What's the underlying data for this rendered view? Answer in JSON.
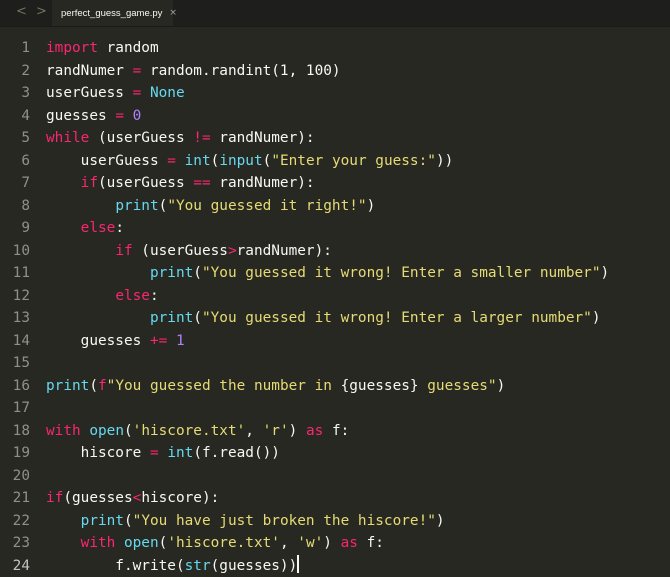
{
  "window": {
    "back_arrow": "<",
    "forward_arrow": ">",
    "tab": {
      "label": "perfect_guess_game.py",
      "close": "×"
    }
  },
  "editor": {
    "current_line": 24,
    "lines": [
      {
        "number": "1",
        "tokens": [
          [
            "kw",
            "import"
          ],
          [
            "pl",
            " random"
          ]
        ]
      },
      {
        "number": "2",
        "tokens": [
          [
            "pl",
            "randNumer "
          ],
          [
            "op",
            "="
          ],
          [
            "pl",
            " random.randint(1, 100)"
          ]
        ]
      },
      {
        "number": "3",
        "tokens": [
          [
            "pl",
            "userGuess "
          ],
          [
            "op",
            "="
          ],
          [
            "pl",
            " "
          ],
          [
            "cn",
            "None"
          ]
        ]
      },
      {
        "number": "4",
        "tokens": [
          [
            "pl",
            "guesses "
          ],
          [
            "op",
            "="
          ],
          [
            "pl",
            " "
          ],
          [
            "nm",
            "0"
          ]
        ]
      },
      {
        "number": "5",
        "tokens": [
          [
            "kw",
            "while"
          ],
          [
            "pl",
            " (userGuess "
          ],
          [
            "op",
            "!="
          ],
          [
            "pl",
            " randNumer):"
          ]
        ]
      },
      {
        "number": "6",
        "tokens": [
          [
            "pl",
            "    userGuess "
          ],
          [
            "op",
            "="
          ],
          [
            "pl",
            " "
          ],
          [
            "fn",
            "int"
          ],
          [
            "pl",
            "("
          ],
          [
            "fn",
            "input"
          ],
          [
            "pl",
            "("
          ],
          [
            "st",
            "\"Enter your guess:\""
          ],
          [
            "pl",
            "))"
          ]
        ]
      },
      {
        "number": "7",
        "tokens": [
          [
            "pl",
            "    "
          ],
          [
            "kw",
            "if"
          ],
          [
            "pl",
            "(userGuess "
          ],
          [
            "op",
            "=="
          ],
          [
            "pl",
            " randNumer):"
          ]
        ]
      },
      {
        "number": "8",
        "tokens": [
          [
            "pl",
            "        "
          ],
          [
            "fn",
            "print"
          ],
          [
            "pl",
            "("
          ],
          [
            "st",
            "\"You guessed it right!\""
          ],
          [
            "pl",
            ")"
          ]
        ]
      },
      {
        "number": "9",
        "tokens": [
          [
            "pl",
            "    "
          ],
          [
            "kw",
            "else"
          ],
          [
            "pl",
            ":"
          ]
        ]
      },
      {
        "number": "10",
        "tokens": [
          [
            "pl",
            "        "
          ],
          [
            "kw",
            "if"
          ],
          [
            "pl",
            " (userGuess"
          ],
          [
            "op",
            ">"
          ],
          [
            "pl",
            "randNumer):"
          ]
        ]
      },
      {
        "number": "11",
        "tokens": [
          [
            "pl",
            "            "
          ],
          [
            "fn",
            "print"
          ],
          [
            "pl",
            "("
          ],
          [
            "st",
            "\"You guessed it wrong! Enter a smaller number\""
          ],
          [
            "pl",
            ")"
          ]
        ]
      },
      {
        "number": "12",
        "tokens": [
          [
            "pl",
            "        "
          ],
          [
            "kw",
            "else"
          ],
          [
            "pl",
            ":"
          ]
        ]
      },
      {
        "number": "13",
        "tokens": [
          [
            "pl",
            "            "
          ],
          [
            "fn",
            "print"
          ],
          [
            "pl",
            "("
          ],
          [
            "st",
            "\"You guessed it wrong! Enter a larger number\""
          ],
          [
            "pl",
            ")"
          ]
        ]
      },
      {
        "number": "14",
        "tokens": [
          [
            "pl",
            "    guesses "
          ],
          [
            "op",
            "+="
          ],
          [
            "pl",
            " "
          ],
          [
            "nm",
            "1"
          ]
        ]
      },
      {
        "number": "15",
        "tokens": []
      },
      {
        "number": "16",
        "tokens": [
          [
            "fn",
            "print"
          ],
          [
            "pl",
            "("
          ],
          [
            "kw",
            "f"
          ],
          [
            "st",
            "\"You guessed the number in "
          ],
          [
            "pl",
            "{guesses}"
          ],
          [
            "st",
            " guesses\""
          ],
          [
            "pl",
            ")"
          ]
        ]
      },
      {
        "number": "17",
        "tokens": []
      },
      {
        "number": "18",
        "tokens": [
          [
            "kw",
            "with"
          ],
          [
            "pl",
            " "
          ],
          [
            "fn",
            "open"
          ],
          [
            "pl",
            "("
          ],
          [
            "st",
            "'hiscore.txt'"
          ],
          [
            "pl",
            ", "
          ],
          [
            "st",
            "'r'"
          ],
          [
            "pl",
            ") "
          ],
          [
            "kw",
            "as"
          ],
          [
            "pl",
            " f:"
          ]
        ]
      },
      {
        "number": "19",
        "tokens": [
          [
            "pl",
            "    hiscore "
          ],
          [
            "op",
            "="
          ],
          [
            "pl",
            " "
          ],
          [
            "fn",
            "int"
          ],
          [
            "pl",
            "(f.read())"
          ]
        ]
      },
      {
        "number": "20",
        "tokens": []
      },
      {
        "number": "21",
        "tokens": [
          [
            "kw",
            "if"
          ],
          [
            "pl",
            "(guesses"
          ],
          [
            "op",
            "<"
          ],
          [
            "pl",
            "hiscore):"
          ]
        ]
      },
      {
        "number": "22",
        "tokens": [
          [
            "pl",
            "    "
          ],
          [
            "fn",
            "print"
          ],
          [
            "pl",
            "("
          ],
          [
            "st",
            "\"You have just broken the hiscore!\""
          ],
          [
            "pl",
            ")"
          ]
        ]
      },
      {
        "number": "23",
        "tokens": [
          [
            "pl",
            "    "
          ],
          [
            "kw",
            "with"
          ],
          [
            "pl",
            " "
          ],
          [
            "fn",
            "open"
          ],
          [
            "pl",
            "("
          ],
          [
            "st",
            "'hiscore.txt'"
          ],
          [
            "pl",
            ", "
          ],
          [
            "st",
            "'w'"
          ],
          [
            "pl",
            ") "
          ],
          [
            "kw",
            "as"
          ],
          [
            "pl",
            " f:"
          ]
        ]
      },
      {
        "number": "24",
        "tokens": [
          [
            "pl",
            "        f.write("
          ],
          [
            "fn",
            "str"
          ],
          [
            "pl",
            "(guesses))"
          ]
        ]
      }
    ]
  },
  "colors": {
    "background": "#272822",
    "keyword": "#f92672",
    "builtin": "#66d9ef",
    "string": "#e6db74",
    "number": "#ae81ff",
    "text": "#f8f8f2",
    "gutter": "#90908a"
  }
}
